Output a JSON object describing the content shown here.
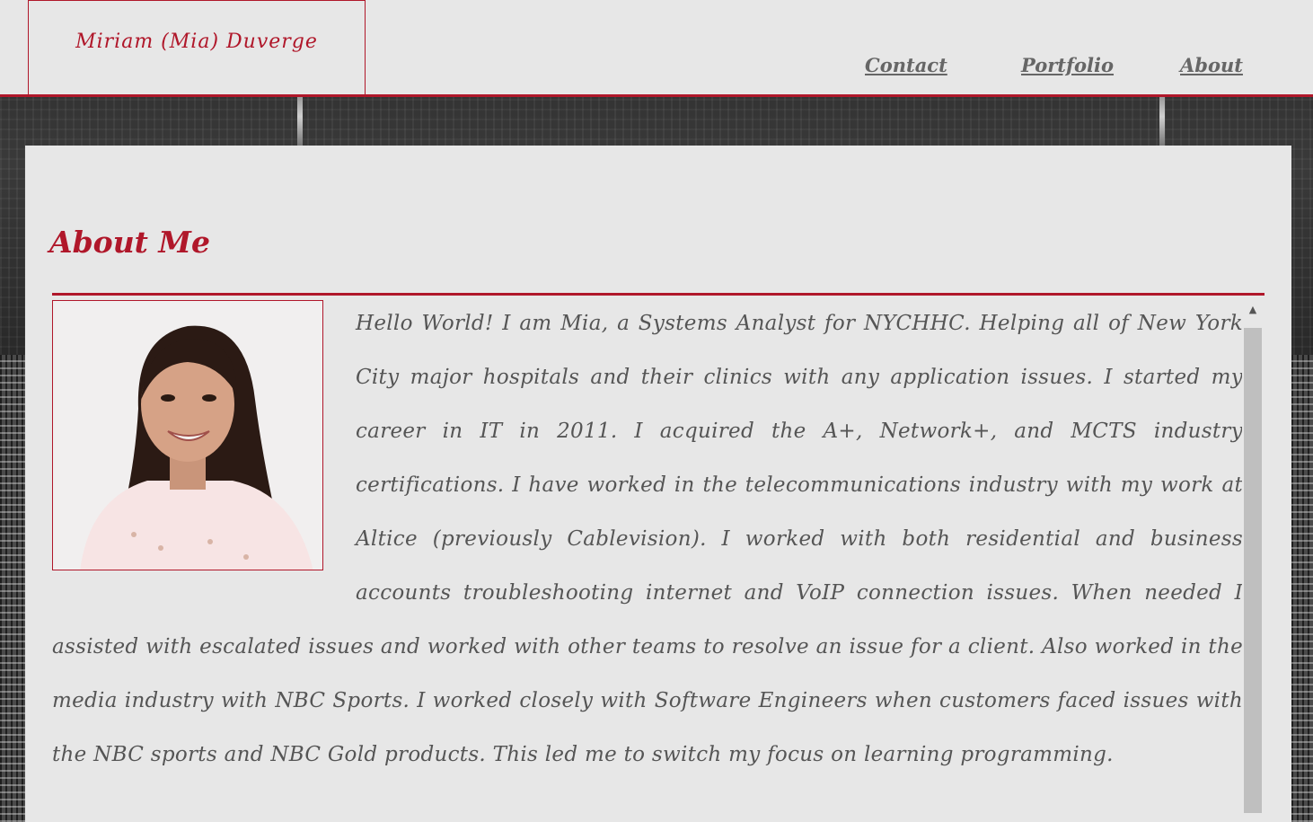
{
  "header": {
    "logo_text": "Miriam (Mia) Duverge",
    "nav": [
      {
        "label": "Contact"
      },
      {
        "label": "Portfolio"
      },
      {
        "label": "About"
      }
    ]
  },
  "main": {
    "section_title": "About Me",
    "photo_alt": "portrait photo",
    "bio": "Hello World! I am Mia, a Systems Analyst for NYCHHC. Helping all of New York City major hospitals and their clinics with any application issues. I started my career in IT in 2011. I acquired the A+, Network+, and MCTS industry certifications. I have worked in the telecommunications industry with my work at Altice (previously Cablevision). I worked with both residential and business accounts troubleshooting internet and VoIP connection issues. When needed I assisted with escalated issues and worked with other teams to resolve an issue for a client. Also worked in the media industry with NBC Sports. I worked closely with Software Engineers when customers faced issues with the NBC sports and NBC Gold products. This led me to switch my focus on learning programming."
  },
  "colors": {
    "accent": "#b0172a",
    "panel_bg": "#e7e7e7",
    "text": "#555555"
  }
}
